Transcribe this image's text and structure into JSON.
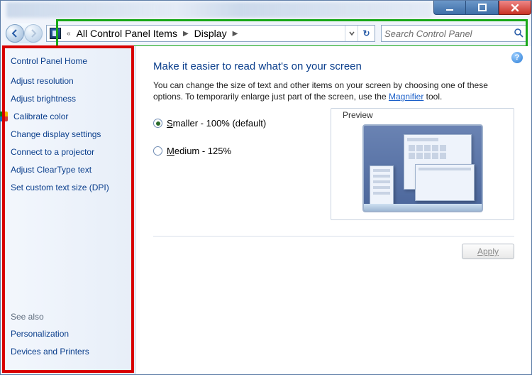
{
  "breadcrumb": {
    "parent": "All Control Panel Items",
    "current": "Display"
  },
  "search": {
    "placeholder": "Search Control Panel"
  },
  "sidebar": {
    "home": "Control Panel Home",
    "links": [
      "Adjust resolution",
      "Adjust brightness",
      "Calibrate color",
      "Change display settings",
      "Connect to a projector",
      "Adjust ClearType text",
      "Set custom text size (DPI)"
    ],
    "seealso_h": "See also",
    "seealso": [
      "Personalization",
      "Devices and Printers"
    ]
  },
  "main": {
    "heading": "Make it easier to read what's on your screen",
    "desc_pre": "You can change the size of text and other items on your screen by choosing one of these options. To temporarily enlarge just part of the screen, use the ",
    "desc_link": "Magnifier",
    "desc_post": " tool.",
    "options": [
      {
        "accel": "S",
        "rest": "maller - 100% (default)",
        "checked": true
      },
      {
        "accel": "M",
        "rest": "edium - 125%",
        "checked": false
      }
    ],
    "preview_label": "Preview",
    "apply": "Apply"
  }
}
